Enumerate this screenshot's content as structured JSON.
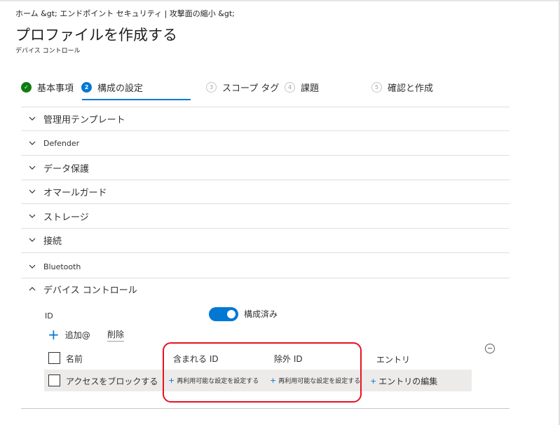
{
  "breadcrumb": "ホーム &gt; エンドポイント セキュリティ | 攻撃面の縮小 &gt;",
  "page_title": "プロファイルを作成する",
  "subtitle": "デバイス コントロール",
  "steps": [
    {
      "num": "✓",
      "label": "基本事項",
      "state": "done"
    },
    {
      "num": "2",
      "label": "構成の設定",
      "state": "active"
    },
    {
      "num": "3",
      "label": "スコープ タグ",
      "state": "pending"
    },
    {
      "num": "4",
      "label": "課題",
      "state": "pending"
    },
    {
      "num": "5",
      "label": "確認と作成",
      "state": "pending"
    }
  ],
  "sections": [
    {
      "label": "管理用テンプレート",
      "expanded": false
    },
    {
      "label": "Defender",
      "expanded": false
    },
    {
      "label": "データ保護",
      "expanded": false
    },
    {
      "label": "オマールガード",
      "expanded": false
    },
    {
      "label": "ストレージ",
      "expanded": false
    },
    {
      "label": "接続",
      "expanded": false
    },
    {
      "label": "Bluetooth",
      "expanded": false
    },
    {
      "label": "デバイス コントロール",
      "expanded": true
    }
  ],
  "device_control": {
    "id_label": "ID",
    "toggle_label": "構成済み",
    "toggle_on": true,
    "add_label": "追加@",
    "delete_label": "削除",
    "columns": {
      "name": "名前",
      "included_id": "含まれる ID",
      "excluded_id": "除外 ID",
      "entries": "エントリ"
    },
    "row": {
      "name": "アクセスをブロックする",
      "included_id": "再利用可能な設定を設定する",
      "excluded_id": "再利用可能な設定を設定する",
      "entries": "エントリの編集"
    }
  },
  "colors": {
    "accent": "#0078d4",
    "success": "#107c10",
    "highlight": "#e81123",
    "row_bg": "#edebe9"
  }
}
